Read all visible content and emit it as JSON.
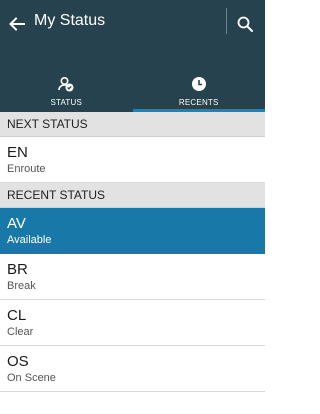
{
  "header": {
    "title": "My Status",
    "back_icon": "arrow-left-icon",
    "search_icon": "search-icon"
  },
  "tabs": [
    {
      "label": "STATUS",
      "icon": "person-check-icon",
      "selected": false
    },
    {
      "label": "RECENTS",
      "icon": "clock-icon",
      "selected": true
    }
  ],
  "next_status": {
    "header": "NEXT STATUS",
    "items": [
      {
        "code": "EN",
        "name": "Enroute"
      }
    ]
  },
  "recent_status": {
    "header": "RECENT STATUS",
    "items": [
      {
        "code": "AV",
        "name": "Available",
        "selected": true
      },
      {
        "code": "BR",
        "name": "Break"
      },
      {
        "code": "CL",
        "name": "Clear"
      },
      {
        "code": "OS",
        "name": "On Scene"
      }
    ]
  },
  "colors": {
    "appbar": "#26424f",
    "tab_indicator": "#1587c0",
    "selected_row": "#1878a8",
    "section_header": "#e2e2e2"
  }
}
